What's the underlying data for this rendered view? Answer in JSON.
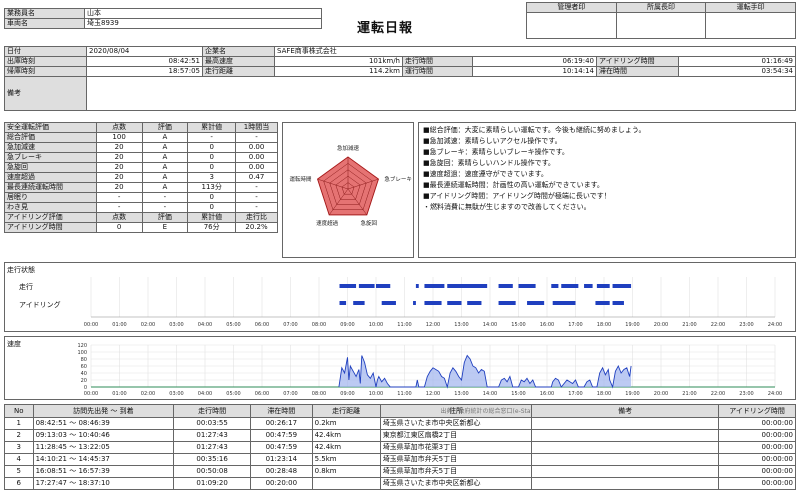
{
  "header": {
    "title": "運転日報",
    "driver_label": "業務員名",
    "driver": "山本",
    "vehicle_label": "車両名",
    "vehicle": "埼玉8939",
    "stamps": [
      "管理者印",
      "所属長印",
      "運転手印"
    ]
  },
  "info": {
    "date_label": "日付",
    "date": "2020/08/04",
    "company_label": "企業名",
    "company": "SAFE商事株式会社",
    "depart_label": "出庫時刻",
    "depart": "08:42:51",
    "maxspeed_label": "最高速度",
    "maxspeed": "101km/h",
    "drivetime_label": "走行時間",
    "drivetime": "06:19:40",
    "idle_label": "アイドリング時間",
    "idle": "01:16:49",
    "return_label": "帰庫時刻",
    "return": "18:57:05",
    "distance_label": "走行距離",
    "distance": "114.2km",
    "optime_label": "運行時間",
    "optime": "10:14:14",
    "stay_label": "滞在時間",
    "stay": "03:54:34",
    "notes_label": "備考"
  },
  "safety": {
    "headers": [
      "安全運転評価",
      "点数",
      "評価",
      "累計値",
      "1時間当"
    ],
    "rows": [
      [
        "総合評価",
        "100",
        "A",
        "-",
        "-"
      ],
      [
        "急加減速",
        "20",
        "A",
        "0",
        "0.00"
      ],
      [
        "急ブレーキ",
        "20",
        "A",
        "0",
        "0.00"
      ],
      [
        "急旋回",
        "20",
        "A",
        "0",
        "0.00"
      ],
      [
        "速度超過",
        "20",
        "A",
        "3",
        "0.47"
      ],
      [
        "最長連続運転時間",
        "20",
        "A",
        "113分",
        "-"
      ],
      [
        "居眠り",
        "-",
        "-",
        "0",
        "-"
      ],
      [
        "わき見",
        "-",
        "-",
        "0",
        "-"
      ]
    ],
    "idle_headers": [
      "アイドリング評価",
      "点数",
      "評価",
      "累計値",
      "走行比"
    ],
    "idle_row": [
      "アイドリング時間",
      "0",
      "E",
      "76分",
      "20.2%"
    ]
  },
  "radar": {
    "labels": [
      "急加減速",
      "急ブレーキ",
      "急旋回",
      "速度超過",
      "運転時間"
    ],
    "values": [
      1,
      1,
      1,
      1,
      1
    ]
  },
  "comments": [
    "■総合評価：大変に素晴らしい運転です。今後も継続に努めましょう。",
    "■急加減速：素晴らしいアクセル操作です。",
    "■急ブレーキ：素晴らしいブレーキ操作です。",
    "■急旋回：素晴らしいハンドル操作です。",
    "■速度超過：速度遵守ができています。",
    "■最長連続運転時間：計画性の高い運転ができています。",
    "■アイドリング時間：アイドリング時間が極端に長いです！",
    "・燃料消費に無駄が生じますので改善してください。"
  ],
  "timeline": {
    "title": "走行状態",
    "drive_label": "走行",
    "idle_label": "アイドリング",
    "ticks": [
      "00:00",
      "01:00",
      "02:00",
      "03:00",
      "04:00",
      "05:00",
      "06:00",
      "07:00",
      "08:00",
      "09:00",
      "10:00",
      "11:00",
      "12:00",
      "13:00",
      "14:00",
      "15:00",
      "16:00",
      "17:00",
      "18:00",
      "19:00",
      "20:00",
      "21:00",
      "22:00",
      "23:00",
      "24:00"
    ],
    "drive_segments": [
      [
        8.72,
        9.3
      ],
      [
        9.4,
        9.95
      ],
      [
        10.0,
        10.5
      ],
      [
        11.4,
        11.5
      ],
      [
        11.7,
        12.4
      ],
      [
        12.5,
        13.9
      ],
      [
        14.3,
        14.8
      ],
      [
        15.0,
        15.6
      ],
      [
        16.15,
        16.4
      ],
      [
        16.5,
        17.1
      ],
      [
        17.3,
        17.6
      ],
      [
        17.75,
        18.2
      ],
      [
        18.3,
        18.95
      ]
    ],
    "idle_segments": [
      [
        8.72,
        8.95
      ],
      [
        9.2,
        9.6
      ],
      [
        10.2,
        10.7
      ],
      [
        11.3,
        11.4
      ],
      [
        11.7,
        12.3
      ],
      [
        12.5,
        13.0
      ],
      [
        13.2,
        13.7
      ],
      [
        14.3,
        14.9
      ],
      [
        15.3,
        15.9
      ],
      [
        16.2,
        17.0
      ],
      [
        17.7,
        18.2
      ],
      [
        18.3,
        18.7
      ]
    ]
  },
  "chart_data": {
    "type": "area",
    "title": "速度",
    "ylim": [
      0,
      120
    ],
    "yticks": [
      0,
      20,
      40,
      60,
      80,
      100,
      120
    ],
    "xlim": [
      0,
      24
    ],
    "x": [
      8.7,
      8.8,
      8.9,
      9.0,
      9.05,
      9.1,
      9.2,
      9.3,
      9.4,
      9.45,
      9.5,
      9.6,
      9.7,
      9.8,
      9.9,
      10.0,
      10.05,
      10.1,
      10.2,
      10.3,
      10.4,
      10.5,
      11.4,
      11.45,
      11.5,
      11.7,
      11.8,
      11.9,
      12.0,
      12.1,
      12.2,
      12.3,
      12.4,
      12.5,
      12.6,
      12.7,
      12.8,
      12.9,
      13.0,
      13.1,
      13.2,
      13.3,
      13.4,
      13.5,
      13.6,
      13.7,
      13.8,
      13.9,
      14.3,
      14.4,
      14.5,
      14.6,
      14.7,
      14.8,
      15.0,
      15.1,
      15.2,
      15.3,
      15.4,
      15.5,
      15.6,
      16.15,
      16.2,
      16.3,
      16.4,
      16.5,
      16.6,
      16.7,
      16.8,
      16.9,
      17.0,
      17.1,
      17.3,
      17.4,
      17.5,
      17.6,
      17.75,
      17.85,
      17.95,
      18.05,
      18.15,
      18.2,
      18.3,
      18.4,
      18.5,
      18.6,
      18.7,
      18.8,
      18.9,
      18.95
    ],
    "y": [
      0,
      55,
      40,
      85,
      20,
      60,
      45,
      30,
      50,
      10,
      90,
      70,
      35,
      25,
      40,
      0,
      20,
      30,
      15,
      25,
      10,
      0,
      0,
      20,
      0,
      0,
      30,
      45,
      55,
      50,
      45,
      30,
      25,
      0,
      40,
      55,
      45,
      30,
      20,
      70,
      90,
      80,
      60,
      55,
      40,
      50,
      45,
      0,
      0,
      20,
      25,
      15,
      30,
      0,
      0,
      20,
      15,
      25,
      10,
      20,
      0,
      0,
      15,
      25,
      20,
      0,
      10,
      20,
      15,
      10,
      20,
      0,
      0,
      15,
      20,
      0,
      0,
      40,
      55,
      35,
      50,
      20,
      0,
      45,
      60,
      40,
      50,
      55,
      30,
      60,
      20,
      0
    ]
  },
  "list": {
    "headers": [
      "No",
      "訪問先出発 ～ 到着",
      "走行時間",
      "滞在時間",
      "走行距離",
      "住所",
      "備考",
      "アイドリング時間"
    ],
    "source": "出典：政府統計の総合窓口(e-Stat)",
    "rows": [
      [
        "1",
        "08:42:51 ～ 08:46:39",
        "00:03:55",
        "00:26:17",
        "0.2km",
        "埼玉県さいたま市中央区新都心",
        "",
        "00:00:00"
      ],
      [
        "2",
        "09:13:03 ～ 10:40:46",
        "01:27:43",
        "00:47:59",
        "42.4km",
        "東京都江東区扇橋2丁目",
        "",
        "00:00:00"
      ],
      [
        "3",
        "11:28:45 ～ 13:22:05",
        "01:27:43",
        "00:47:59",
        "42.4km",
        "埼玉県草加市花栗3丁目",
        "",
        "00:00:00"
      ],
      [
        "4",
        "14:10:21 ～ 14:45:37",
        "00:35:16",
        "01:23:14",
        "5.5km",
        "埼玉県草加市弁天5丁目",
        "",
        "00:00:00"
      ],
      [
        "5",
        "16:08:51 ～ 16:57:39",
        "00:50:08",
        "00:28:48",
        "0.8km",
        "埼玉県草加市弁天5丁目",
        "",
        "00:00:00"
      ],
      [
        "6",
        "17:27:47 ～ 18:37:10",
        "01:09:20",
        "00:20:00",
        "",
        "埼玉県さいたま市中央区新都心",
        "",
        "00:00:00"
      ]
    ]
  },
  "colors": {
    "label_bg": "#dedede",
    "bar_blue": "#1f3fbf",
    "radar_fill": "#e57373",
    "radar_stroke": "#c62828"
  }
}
